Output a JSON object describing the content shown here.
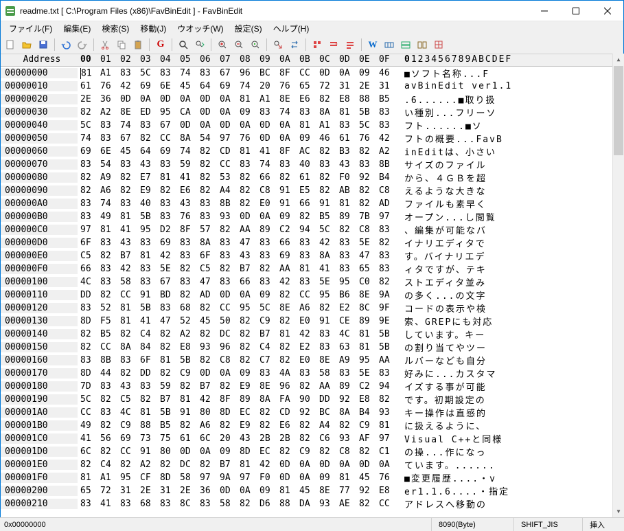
{
  "window": {
    "title": "readme.txt [ C:\\Program Files (x86)\\FavBinEdit ] - FavBinEdit"
  },
  "menu": {
    "file": "ファイル(F)",
    "edit": "編集(E)",
    "search": "検索(S)",
    "move": "移動(J)",
    "watch": "ウオッチ(W)",
    "settings": "設定(S)",
    "help": "ヘルプ(H)"
  },
  "toolbar_icons": {
    "new": "new",
    "open": "open",
    "save": "save",
    "undo": "undo",
    "redo": "redo",
    "cut": "cut",
    "copy": "copy",
    "paste": "paste",
    "grep": "G",
    "find": "find",
    "findnext": "findnext",
    "zoomin": "zoomin",
    "zoomout": "zoomout",
    "zoomreset": "zoomreset",
    "jump": "jump",
    "replace": "replace",
    "bk1": "bk1",
    "bk2": "bk2",
    "bk3": "bk3",
    "w": "W",
    "d1": "d1",
    "d2": "d2",
    "d3": "d3",
    "d4": "d4"
  },
  "header": {
    "address": "Address",
    "bytes": [
      "00",
      "01",
      "02",
      "03",
      "04",
      "05",
      "06",
      "07",
      "08",
      "09",
      "0A",
      "0B",
      "0C",
      "0D",
      "0E",
      "0F"
    ],
    "ascii": "0123456789ABCDEF"
  },
  "rows": [
    {
      "addr": "00000000",
      "hex": [
        "81",
        "A1",
        "83",
        "5C",
        "83",
        "74",
        "83",
        "67",
        "96",
        "BC",
        "8F",
        "CC",
        "0D",
        "0A",
        "09",
        "46"
      ],
      "txt": "■ソフト名称...F"
    },
    {
      "addr": "00000010",
      "hex": [
        "61",
        "76",
        "42",
        "69",
        "6E",
        "45",
        "64",
        "69",
        "74",
        "20",
        "76",
        "65",
        "72",
        "31",
        "2E",
        "31"
      ],
      "txt": "avBinEdit ver1.1"
    },
    {
      "addr": "00000020",
      "hex": [
        "2E",
        "36",
        "0D",
        "0A",
        "0D",
        "0A",
        "0D",
        "0A",
        "81",
        "A1",
        "8E",
        "E6",
        "82",
        "E8",
        "88",
        "B5"
      ],
      "txt": ".6......■取り扱"
    },
    {
      "addr": "00000030",
      "hex": [
        "82",
        "A2",
        "8E",
        "ED",
        "95",
        "CA",
        "0D",
        "0A",
        "09",
        "83",
        "74",
        "83",
        "8A",
        "81",
        "5B",
        "83"
      ],
      "txt": "い種別...フリーソ"
    },
    {
      "addr": "00000040",
      "hex": [
        "5C",
        "83",
        "74",
        "83",
        "67",
        "0D",
        "0A",
        "0D",
        "0A",
        "0D",
        "0A",
        "81",
        "A1",
        "83",
        "5C",
        "83"
      ],
      "txt": "フト......■ソ"
    },
    {
      "addr": "00000050",
      "hex": [
        "74",
        "83",
        "67",
        "82",
        "CC",
        "8A",
        "54",
        "97",
        "76",
        "0D",
        "0A",
        "09",
        "46",
        "61",
        "76",
        "42"
      ],
      "txt": "フトの概要...FavB"
    },
    {
      "addr": "00000060",
      "hex": [
        "69",
        "6E",
        "45",
        "64",
        "69",
        "74",
        "82",
        "CD",
        "81",
        "41",
        "8F",
        "AC",
        "82",
        "B3",
        "82",
        "A2"
      ],
      "txt": "inEditは、小さい"
    },
    {
      "addr": "00000070",
      "hex": [
        "83",
        "54",
        "83",
        "43",
        "83",
        "59",
        "82",
        "CC",
        "83",
        "74",
        "83",
        "40",
        "83",
        "43",
        "83",
        "8B"
      ],
      "txt": "サイズのファイル"
    },
    {
      "addr": "00000080",
      "hex": [
        "82",
        "A9",
        "82",
        "E7",
        "81",
        "41",
        "82",
        "53",
        "82",
        "66",
        "82",
        "61",
        "82",
        "F0",
        "92",
        "B4"
      ],
      "txt": "から、４ＧＢを超"
    },
    {
      "addr": "00000090",
      "hex": [
        "82",
        "A6",
        "82",
        "E9",
        "82",
        "E6",
        "82",
        "A4",
        "82",
        "C8",
        "91",
        "E5",
        "82",
        "AB",
        "82",
        "C8"
      ],
      "txt": "えるような大きな"
    },
    {
      "addr": "000000A0",
      "hex": [
        "83",
        "74",
        "83",
        "40",
        "83",
        "43",
        "83",
        "8B",
        "82",
        "E0",
        "91",
        "66",
        "91",
        "81",
        "82",
        "AD"
      ],
      "txt": "ファイルも素早く"
    },
    {
      "addr": "000000B0",
      "hex": [
        "83",
        "49",
        "81",
        "5B",
        "83",
        "76",
        "83",
        "93",
        "0D",
        "0A",
        "09",
        "82",
        "B5",
        "89",
        "7B",
        "97"
      ],
      "txt": "オープン...し閲覧"
    },
    {
      "addr": "000000C0",
      "hex": [
        "97",
        "81",
        "41",
        "95",
        "D2",
        "8F",
        "57",
        "82",
        "AA",
        "89",
        "C2",
        "94",
        "5C",
        "82",
        "C8",
        "83"
      ],
      "txt": "、編集が可能なバ"
    },
    {
      "addr": "000000D0",
      "hex": [
        "6F",
        "83",
        "43",
        "83",
        "69",
        "83",
        "8A",
        "83",
        "47",
        "83",
        "66",
        "83",
        "42",
        "83",
        "5E",
        "82"
      ],
      "txt": "イナリエディタで"
    },
    {
      "addr": "000000E0",
      "hex": [
        "C5",
        "82",
        "B7",
        "81",
        "42",
        "83",
        "6F",
        "83",
        "43",
        "83",
        "69",
        "83",
        "8A",
        "83",
        "47",
        "83"
      ],
      "txt": "す。バイナリエデ"
    },
    {
      "addr": "000000F0",
      "hex": [
        "66",
        "83",
        "42",
        "83",
        "5E",
        "82",
        "C5",
        "82",
        "B7",
        "82",
        "AA",
        "81",
        "41",
        "83",
        "65",
        "83"
      ],
      "txt": "ィタですが、テキ"
    },
    {
      "addr": "00000100",
      "hex": [
        "4C",
        "83",
        "58",
        "83",
        "67",
        "83",
        "47",
        "83",
        "66",
        "83",
        "42",
        "83",
        "5E",
        "95",
        "C0",
        "82"
      ],
      "txt": "ストエディタ並み"
    },
    {
      "addr": "00000110",
      "hex": [
        "DD",
        "82",
        "CC",
        "91",
        "BD",
        "82",
        "AD",
        "0D",
        "0A",
        "09",
        "82",
        "CC",
        "95",
        "B6",
        "8E",
        "9A"
      ],
      "txt": "の多く...の文字"
    },
    {
      "addr": "00000120",
      "hex": [
        "83",
        "52",
        "81",
        "5B",
        "83",
        "68",
        "82",
        "CC",
        "95",
        "5C",
        "8E",
        "A6",
        "82",
        "E2",
        "8C",
        "9F"
      ],
      "txt": "コードの表示や検"
    },
    {
      "addr": "00000130",
      "hex": [
        "8D",
        "F5",
        "81",
        "41",
        "47",
        "52",
        "45",
        "50",
        "82",
        "C9",
        "82",
        "E0",
        "91",
        "CE",
        "89",
        "9E"
      ],
      "txt": "索、GREPにも対応"
    },
    {
      "addr": "00000140",
      "hex": [
        "82",
        "B5",
        "82",
        "C4",
        "82",
        "A2",
        "82",
        "DC",
        "82",
        "B7",
        "81",
        "42",
        "83",
        "4C",
        "81",
        "5B"
      ],
      "txt": "しています。キー"
    },
    {
      "addr": "00000150",
      "hex": [
        "82",
        "CC",
        "8A",
        "84",
        "82",
        "E8",
        "93",
        "96",
        "82",
        "C4",
        "82",
        "E2",
        "83",
        "63",
        "81",
        "5B"
      ],
      "txt": "の割り当てやツー"
    },
    {
      "addr": "00000160",
      "hex": [
        "83",
        "8B",
        "83",
        "6F",
        "81",
        "5B",
        "82",
        "C8",
        "82",
        "C7",
        "82",
        "E0",
        "8E",
        "A9",
        "95",
        "AA"
      ],
      "txt": "ルバーなども自分"
    },
    {
      "addr": "00000170",
      "hex": [
        "8D",
        "44",
        "82",
        "DD",
        "82",
        "C9",
        "0D",
        "0A",
        "09",
        "83",
        "4A",
        "83",
        "58",
        "83",
        "5E",
        "83"
      ],
      "txt": "好みに...カスタマ"
    },
    {
      "addr": "00000180",
      "hex": [
        "7D",
        "83",
        "43",
        "83",
        "59",
        "82",
        "B7",
        "82",
        "E9",
        "8E",
        "96",
        "82",
        "AA",
        "89",
        "C2",
        "94"
      ],
      "txt": "イズする事が可能"
    },
    {
      "addr": "00000190",
      "hex": [
        "5C",
        "82",
        "C5",
        "82",
        "B7",
        "81",
        "42",
        "8F",
        "89",
        "8A",
        "FA",
        "90",
        "DD",
        "92",
        "E8",
        "82"
      ],
      "txt": "です。初期設定の"
    },
    {
      "addr": "000001A0",
      "hex": [
        "CC",
        "83",
        "4C",
        "81",
        "5B",
        "91",
        "80",
        "8D",
        "EC",
        "82",
        "CD",
        "92",
        "BC",
        "8A",
        "B4",
        "93"
      ],
      "txt": "キー操作は直感的"
    },
    {
      "addr": "000001B0",
      "hex": [
        "49",
        "82",
        "C9",
        "88",
        "B5",
        "82",
        "A6",
        "82",
        "E9",
        "82",
        "E6",
        "82",
        "A4",
        "82",
        "C9",
        "81"
      ],
      "txt": "に扱えるように、"
    },
    {
      "addr": "000001C0",
      "hex": [
        "41",
        "56",
        "69",
        "73",
        "75",
        "61",
        "6C",
        "20",
        "43",
        "2B",
        "2B",
        "82",
        "C6",
        "93",
        "AF",
        "97"
      ],
      "txt": "Visual C++と同様"
    },
    {
      "addr": "000001D0",
      "hex": [
        "6C",
        "82",
        "CC",
        "91",
        "80",
        "0D",
        "0A",
        "09",
        "8D",
        "EC",
        "82",
        "C9",
        "82",
        "C8",
        "82",
        "C1"
      ],
      "txt": "の操...作になっ"
    },
    {
      "addr": "000001E0",
      "hex": [
        "82",
        "C4",
        "82",
        "A2",
        "82",
        "DC",
        "82",
        "B7",
        "81",
        "42",
        "0D",
        "0A",
        "0D",
        "0A",
        "0D",
        "0A"
      ],
      "txt": "ています。......"
    },
    {
      "addr": "000001F0",
      "hex": [
        "81",
        "A1",
        "95",
        "CF",
        "8D",
        "58",
        "97",
        "9A",
        "97",
        "F0",
        "0D",
        "0A",
        "09",
        "81",
        "45",
        "76"
      ],
      "txt": "■変更履歴....・v"
    },
    {
      "addr": "00000200",
      "hex": [
        "65",
        "72",
        "31",
        "2E",
        "31",
        "2E",
        "36",
        "0D",
        "0A",
        "09",
        "81",
        "45",
        "8E",
        "77",
        "92",
        "E8"
      ],
      "txt": "er1.1.6....・指定"
    },
    {
      "addr": "00000210",
      "hex": [
        "83",
        "41",
        "83",
        "68",
        "83",
        "8C",
        "83",
        "58",
        "82",
        "D6",
        "88",
        "DA",
        "93",
        "AE",
        "82",
        "CC"
      ],
      "txt": "アドレスへ移動の"
    }
  ],
  "status": {
    "addr": "0x00000000",
    "size": "8090(Byte)",
    "encoding": "SHIFT_JIS",
    "mode": "挿入"
  }
}
